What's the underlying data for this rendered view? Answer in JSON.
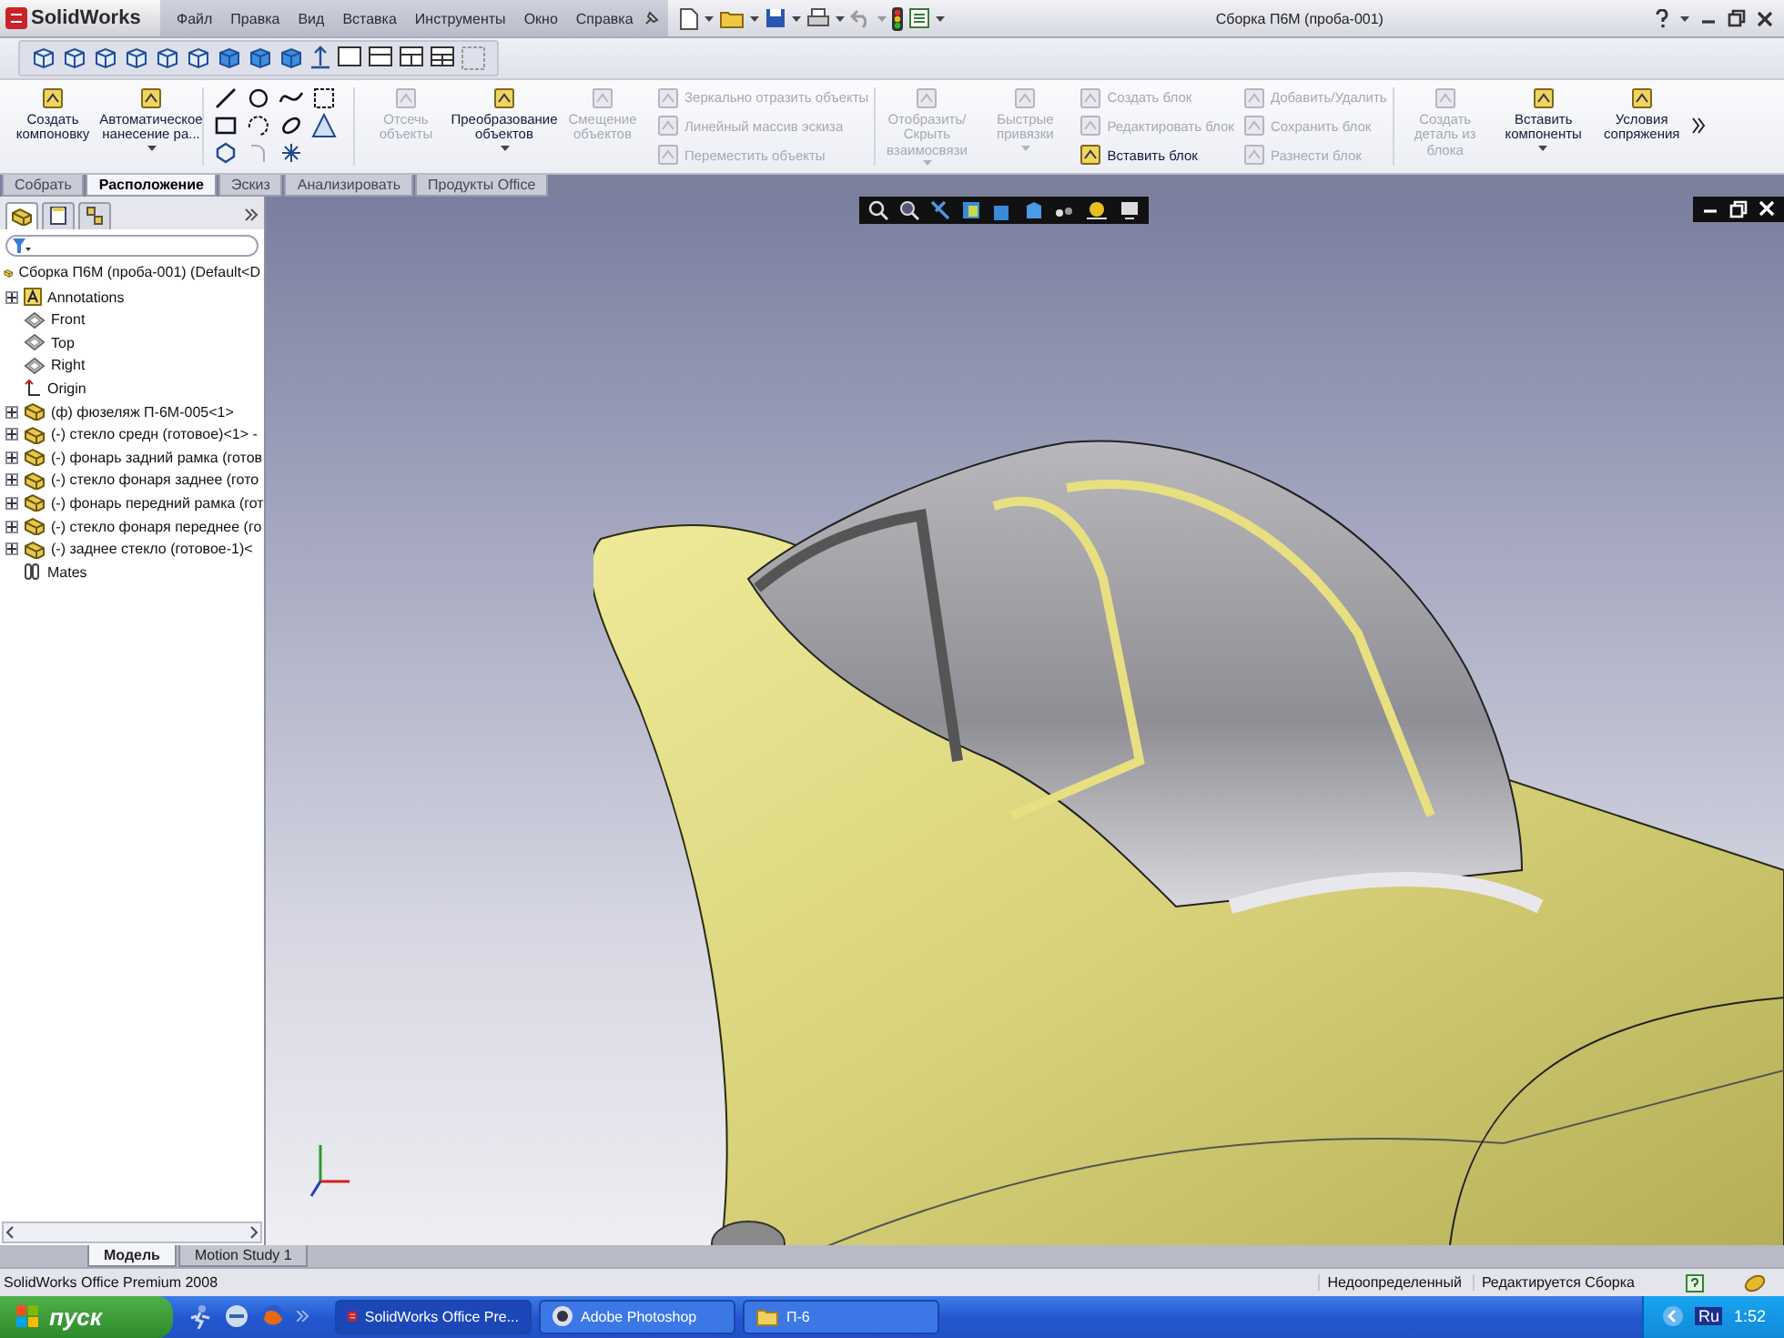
{
  "app": {
    "logo": "SolidWorks",
    "window_title": "Сборка П6М (проба-001)"
  },
  "menu": [
    "Файл",
    "Правка",
    "Вид",
    "Вставка",
    "Инструменты",
    "Окно",
    "Справка"
  ],
  "ribbon": {
    "groups": [
      {
        "kind": "large",
        "label": "Создать компоновку",
        "disabled": false,
        "dropdown": false
      },
      {
        "kind": "large",
        "label": "Автоматическое нанесение ра...",
        "disabled": false,
        "dropdown": true
      },
      {
        "kind": "sketch_tools"
      },
      {
        "kind": "large",
        "label": "Отсечь объекты",
        "disabled": true,
        "dropdown": false
      },
      {
        "kind": "large",
        "label": "Преобразование объектов",
        "disabled": false,
        "dropdown": true
      },
      {
        "kind": "large",
        "label": "Смещение объектов",
        "disabled": true,
        "dropdown": false
      },
      {
        "kind": "stack",
        "items": [
          {
            "label": "Зеркально отразить объекты",
            "disabled": true
          },
          {
            "label": "Линейный массив эскиза",
            "disabled": true
          },
          {
            "label": "Переместить объекты",
            "disabled": true
          }
        ]
      },
      {
        "kind": "large",
        "label": "Отобразить/Скрыть взаимосвязи",
        "disabled": true,
        "dropdown": true
      },
      {
        "kind": "large",
        "label": "Быстрые привязки",
        "disabled": true,
        "dropdown": true
      },
      {
        "kind": "stack",
        "items": [
          {
            "label": "Создать блок",
            "disabled": true
          },
          {
            "label": "Редактировать блок",
            "disabled": true
          },
          {
            "label": "Вставить блок",
            "disabled": false
          }
        ]
      },
      {
        "kind": "stack",
        "items": [
          {
            "label": "Добавить/Удалить",
            "disabled": true
          },
          {
            "label": "Сохранить блок",
            "disabled": true
          },
          {
            "label": "Разнести блок",
            "disabled": true
          }
        ]
      },
      {
        "kind": "large",
        "label": "Создать деталь из блока",
        "disabled": true,
        "dropdown": false
      },
      {
        "kind": "large",
        "label": "Вставить компоненты",
        "disabled": false,
        "dropdown": true
      },
      {
        "kind": "large",
        "label": "Условия сопряжения",
        "disabled": false,
        "dropdown": false
      }
    ]
  },
  "ribbon_tabs": [
    {
      "label": "Собрать",
      "selected": false
    },
    {
      "label": "Расположение",
      "selected": true
    },
    {
      "label": "Эскиз",
      "selected": false
    },
    {
      "label": "Анализировать",
      "selected": false
    },
    {
      "label": "Продукты Office",
      "selected": false
    }
  ],
  "panel_tabs": [
    {
      "kind": "features",
      "selected": true
    },
    {
      "kind": "properties",
      "selected": false
    },
    {
      "kind": "configurations",
      "selected": false
    }
  ],
  "tree": {
    "root": "Сборка П6М (проба-001)  (Default<D",
    "items": [
      {
        "kind": "annotations",
        "label": "Annotations",
        "expandable": true
      },
      {
        "kind": "plane",
        "label": "Front",
        "expandable": false
      },
      {
        "kind": "plane",
        "label": "Top",
        "expandable": false
      },
      {
        "kind": "plane",
        "label": "Right",
        "expandable": false
      },
      {
        "kind": "origin",
        "label": "Origin",
        "expandable": false
      },
      {
        "kind": "part",
        "label": "(ф) фюзеляж П-6М-005<1>",
        "expandable": true
      },
      {
        "kind": "part",
        "label": "(-) стекло средн (готовое)<1> -",
        "expandable": true
      },
      {
        "kind": "part",
        "label": "(-) фонарь задний рамка (готов",
        "expandable": true
      },
      {
        "kind": "part",
        "label": "(-) стекло фонаря заднее (гото",
        "expandable": true
      },
      {
        "kind": "part",
        "label": "(-) фонарь передний рамка (гот",
        "expandable": true
      },
      {
        "kind": "part",
        "label": "(-) стекло фонаря переднее (го",
        "expandable": true
      },
      {
        "kind": "part",
        "label": "(-) заднее стекло (готовое-1)<",
        "expandable": true
      },
      {
        "kind": "mates",
        "label": "Mates",
        "expandable": false
      }
    ]
  },
  "bottom_tabs": [
    {
      "label": "Модель",
      "selected": true
    },
    {
      "label": "Motion Study 1",
      "selected": false
    }
  ],
  "status_bar": {
    "text": "SolidWorks Office Premium 2008",
    "items": [
      "Недоопределенный",
      "Редактируется Сборка"
    ]
  },
  "taskbar": {
    "start": "пуск",
    "tasks": [
      {
        "label": "SolidWorks Office Pre...",
        "kind": "solidworks",
        "selected": true
      },
      {
        "label": "Adobe Photoshop",
        "kind": "photoshop",
        "selected": false
      },
      {
        "label": "П-6",
        "kind": "folder",
        "selected": false
      }
    ],
    "language": "Ru",
    "time": "1:52"
  }
}
